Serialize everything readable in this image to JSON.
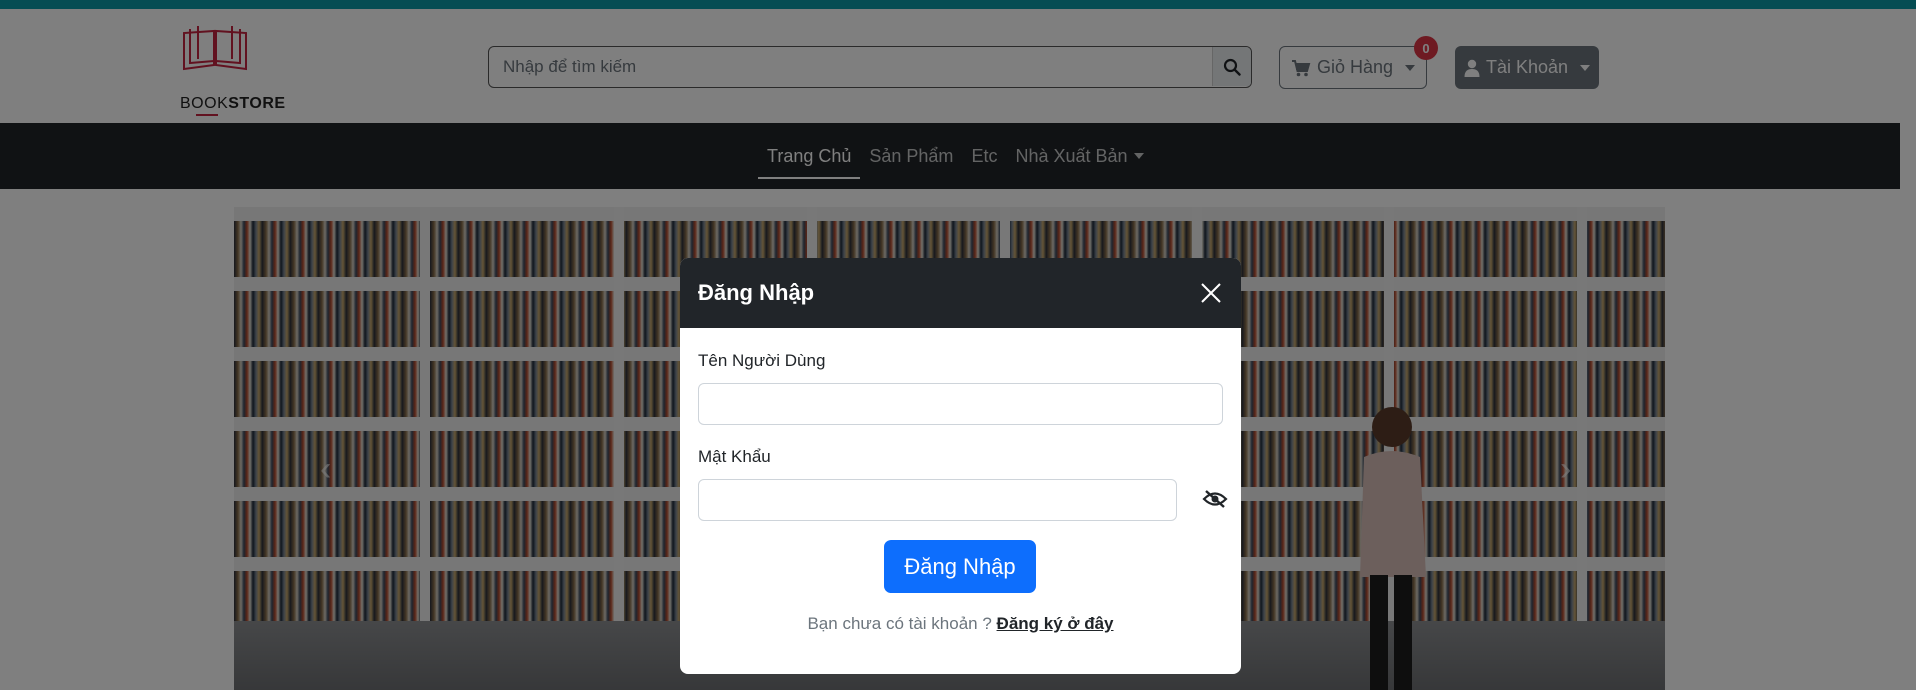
{
  "header": {
    "logo_prefix": "BOOK",
    "logo_suffix": "STORE",
    "search_placeholder": "Nhập để tìm kiếm",
    "cart_label": "Giỏ Hàng",
    "cart_count": "0",
    "account_label": "Tài Khoản"
  },
  "nav": {
    "items": [
      {
        "label": "Trang Chủ"
      },
      {
        "label": "Sản Phẩm"
      },
      {
        "label": "Etc"
      },
      {
        "label": "Nhà Xuất Bản"
      }
    ]
  },
  "carousel": {
    "prev_icon": "‹",
    "next_icon": "›"
  },
  "modal": {
    "title": "Đăng Nhập",
    "username_label": "Tên Người Dùng",
    "password_label": "Mật Khẩu",
    "submit_label": "Đăng Nhập",
    "register_prompt": "Bạn chưa có tài khoản ?",
    "register_link": "Đăng ký ở đây"
  },
  "colors": {
    "accent": "#0b9aa6",
    "nav_bg": "#212529",
    "primary": "#0d6efd",
    "badge": "#dc3545"
  }
}
